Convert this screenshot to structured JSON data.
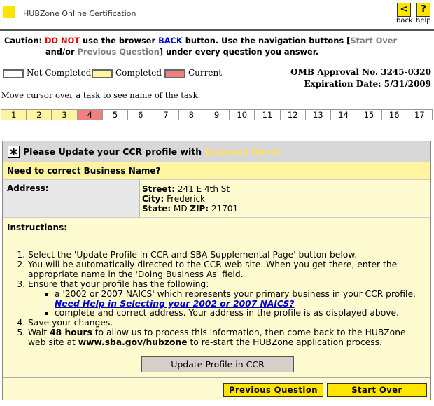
{
  "header": {
    "title": "HUBZone Online Certification",
    "back_icon": "<",
    "back_label": "back",
    "help_icon": "?",
    "help_label": "help"
  },
  "caution": {
    "prefix": "Caution:",
    "do_not": "DO NOT",
    "text1": " use the browser ",
    "back": "BACK",
    "text2": " button. Use the navigation buttons [",
    "start_over": "Start Over",
    "text3": "and/or ",
    "previous_question": "Previous Question",
    "text4": "] under every question you answer."
  },
  "legend": {
    "not_completed": "Not Completed",
    "completed": "Completed",
    "current": "Current",
    "colors": {
      "not_completed": "#ffffff",
      "completed": "#fff4a0",
      "current": "#f08080"
    }
  },
  "omb": {
    "approval": "OMB Approval No. 3245-0320",
    "expiration": "Expiration Date: 5/31/2009"
  },
  "hint": "Move cursor over a task to see name of the task.",
  "tasks": [
    {
      "label": "1",
      "state": "completed"
    },
    {
      "label": "2",
      "state": "completed"
    },
    {
      "label": "3",
      "state": "completed"
    },
    {
      "label": "4",
      "state": "current"
    },
    {
      "label": "5",
      "state": "not_completed"
    },
    {
      "label": "6",
      "state": "not_completed"
    },
    {
      "label": "7",
      "state": "not_completed"
    },
    {
      "label": "8",
      "state": "not_completed"
    },
    {
      "label": "9",
      "state": "not_completed"
    },
    {
      "label": "10",
      "state": "not_completed"
    },
    {
      "label": "11",
      "state": "not_completed"
    },
    {
      "label": "12",
      "state": "not_completed"
    },
    {
      "label": "13",
      "state": "not_completed"
    },
    {
      "label": "14",
      "state": "not_completed"
    },
    {
      "label": "15",
      "state": "not_completed"
    },
    {
      "label": "16",
      "state": "not_completed"
    },
    {
      "label": "17",
      "state": "not_completed"
    }
  ],
  "panel": {
    "star_icon": "✱",
    "title_prefix": "Please Update your CCR profile with ",
    "title_highlight": "Business Name",
    "correct_question": "Need to correct Business Name?",
    "address_label": "Address:",
    "street_label": "Street:",
    "street_value": " 241 E 4th St",
    "city_label": "City:",
    "city_value": " Frederick",
    "state_label": "State:",
    "state_value": " MD ",
    "zip_label": "ZIP:",
    "zip_value": " 21701",
    "instructions_label": "Instructions:",
    "steps": {
      "s1": "Select the 'Update Profile in CCR and SBA Supplemental Page' button below.",
      "s2": "You will be automatically directed to the CCR web site. When you get there, enter the appropriate name in the 'Doing Business As' field.",
      "s3": "Ensure that your profile has the following:",
      "s3a": "a '2002 or 2007 NAICS' which represents your primary business in your CCR profile. ",
      "s3a_link": "Need Help in Selecting your 2002 or 2007 NAICS?",
      "s3b": "complete and correct address. Your address in the profile is as displayed above.",
      "s4": "Save your changes.",
      "s5a": "Wait ",
      "s5b": "48 hours",
      "s5c": " to allow us to process this information, then come back to the HUBZone web site at ",
      "s5d": "www.sba.gov/hubzone",
      "s5e": " to re-start the HUBZone application process."
    },
    "update_button": "Update Profile in CCR",
    "previous_button": "Previous Question",
    "start_over_button": "Start Over"
  }
}
